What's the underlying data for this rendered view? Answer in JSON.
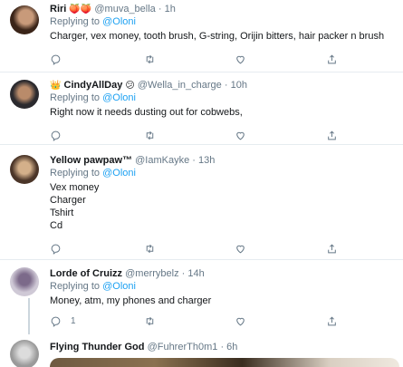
{
  "replying_label": "Replying to",
  "replying_handle": "@Oloni",
  "tweets": [
    {
      "name": "Riri",
      "name_emoji": "🍑🍑",
      "handle": "@muva_bella",
      "time": "1h",
      "body": [
        "Charger, vex money, tooth brush, G-string, Orijin bitters, hair packer n brush"
      ],
      "reply_count": "",
      "avatar_colors": [
        "#3a2418",
        "#c89a7a"
      ]
    },
    {
      "name": "CindyAllDay",
      "name_prefix_emoji": "👑",
      "name_emoji": "😕",
      "handle": "@Wella_in_charge",
      "time": "10h",
      "body": [
        "Right now it needs dusting out for cobwebs,"
      ],
      "reply_count": "",
      "avatar_colors": [
        "#2b2a2e",
        "#b98b6a"
      ]
    },
    {
      "name": "Yellow pawpaw™",
      "handle": "@IamKayke",
      "time": "13h",
      "body": [
        "Vex money",
        "Charger",
        "Tshirt",
        "Cd"
      ],
      "reply_count": "",
      "avatar_colors": [
        "#4b3528",
        "#d4b08a"
      ]
    },
    {
      "name": "Lorde of Cruizz",
      "handle": "@merrybelz",
      "time": "14h",
      "body": [
        "Money, atm, my phones and charger"
      ],
      "reply_count": "1",
      "avatar_colors": [
        "#cfc9d6",
        "#7c6a8a"
      ]
    },
    {
      "name": "Flying Thunder God",
      "handle": "@FuhrerTh0m1",
      "time": "6h",
      "body": [],
      "reply_count": "",
      "avatar_colors": [
        "#9a9a9a",
        "#dcdcdc"
      ]
    }
  ]
}
